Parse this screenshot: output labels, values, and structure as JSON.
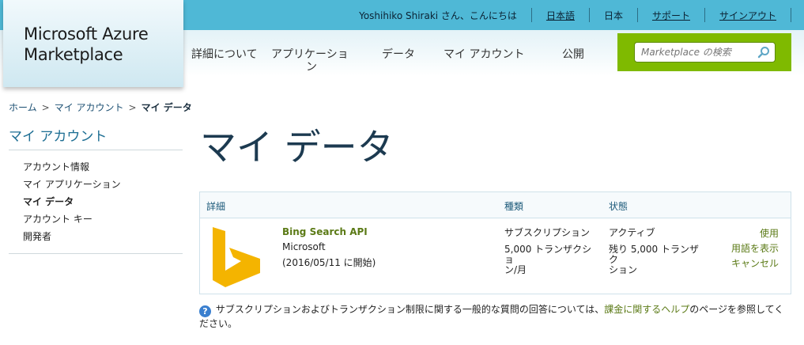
{
  "topbar": {
    "greeting": "Yoshihiko Shiraki さん、こんにちは",
    "language": "日本語",
    "region": "日本",
    "support": "サポート",
    "signout": "サインアウト"
  },
  "logo": {
    "line1": "Microsoft Azure",
    "line2": "Marketplace"
  },
  "nav": {
    "details": "詳細について",
    "applications": "アプリケーショ",
    "applications_wrap": "ン",
    "data": "データ",
    "my_account": "マイ アカウント",
    "publish": "公開"
  },
  "search": {
    "placeholder": "Marketplace の検索",
    "icon": "search-icon",
    "panel_color": "#7fba00"
  },
  "breadcrumb": {
    "home": "ホーム",
    "account": "マイ アカウント",
    "current": "マイ データ"
  },
  "sidebar": {
    "title": "マイ アカウント",
    "items": [
      {
        "label": "アカウント情報"
      },
      {
        "label": "マイ アプリケーション"
      },
      {
        "label": "マイ データ"
      },
      {
        "label": "アカウント キー"
      },
      {
        "label": "開発者"
      }
    ]
  },
  "main": {
    "title": "マイ データ",
    "table": {
      "headers": {
        "details": "詳細",
        "type": "種類",
        "status": "状態"
      },
      "row": {
        "product_name": "Bing Search API",
        "publisher": "Microsoft",
        "start_date": "(2016/05/11 に開始)",
        "type_line1": "サブスクリプション",
        "type_line2": "5,000 トランザクショ",
        "type_line3": "ン/月",
        "status_line1": "アクティブ",
        "status_line2": "残り 5,000 トランザク",
        "status_line3": "ション",
        "action_use": "使用",
        "action_terms": "用語を表示",
        "action_cancel": "キャンセル",
        "logo_color": "#f4b400"
      }
    },
    "help": {
      "text_before": "サブスクリプションおよびトランザクション制限に関する一般的な質問の回答については、",
      "link": "課金に関するヘルプ",
      "text_after": "のページを参照してください。"
    }
  },
  "colors": {
    "topbar": "#4fb8d6",
    "accent_green": "#5b7a16",
    "title": "#1c3a50"
  }
}
